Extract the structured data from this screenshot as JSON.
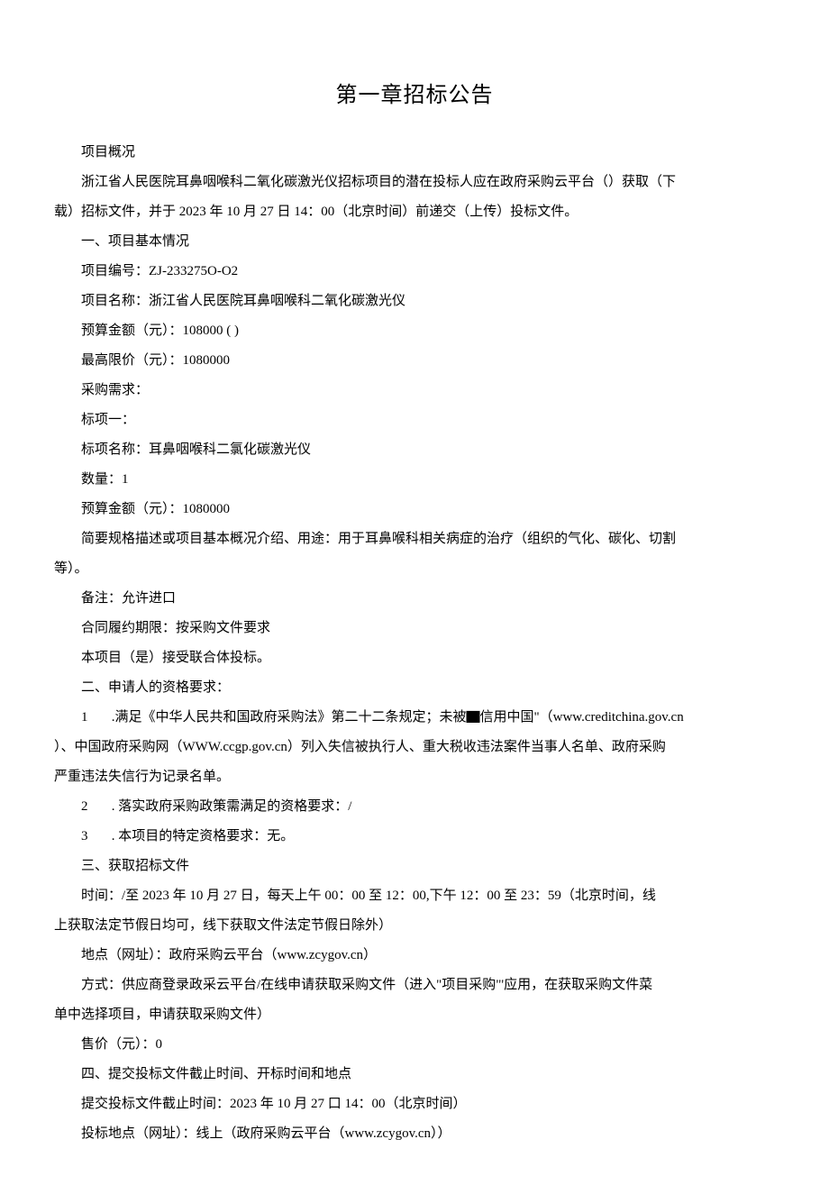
{
  "title": "第一章招标公告",
  "lines": {
    "l1": "项目概况",
    "l2": "浙江省人民医院耳鼻咽喉科二氧化碳激光仪招标项目的潜在投标人应在政府采购云平台（）获取（下",
    "l3": "载）招标文件，并于 2023 年 10 月 27 日 14：00（北京时间）前递交（上传）投标文件。",
    "l4": "一、项目基本情况",
    "l5": "项目编号：ZJ-233275O-O2",
    "l6": "项目名称：浙江省人民医院耳鼻咽喉科二氧化碳激光仪",
    "l7": "预算金额（元）：108000 ( )",
    "l8": "最高限价（元）：1080000",
    "l9": "采购需求：",
    "l10": "标项一：",
    "l11": "标项名称：耳鼻咽喉科二氯化碳激光仪",
    "l12": "数量：1",
    "l13": "预算金额（元）：1080000",
    "l14": "简要规格描述或项目基本概况介绍、用途：用于耳鼻喉科相关病症的治疗（组织的气化、碳化、切割",
    "l15": "等）。",
    "l16": "备注：允许进口",
    "l17": "合同履约期限：按采购文件要求",
    "l18": "本项目（是）接受联合体投标。",
    "l19": "二、申请人的资格要求：",
    "l20a": "1",
    "l20b": " .满足《中华人民共和国政府采购法》第二十二条规定；未被▇信用中国\"（www.creditchina.gov.cn",
    "l21": "）、中国政府采购网（WWW.ccgp.gov.cn）列入失信被执行人、重大税收违法案件当事人名单、政府采购",
    "l22": "严重违法失信行为记录名单。",
    "l23a": "2",
    "l23b": " . 落实政府采购政策需满足的资格要求：/",
    "l24a": "3",
    "l24b": " . 本项目的特定资格要求：无。",
    "l25": "三、获取招标文件",
    "l26": "时间：/至 2023 年 10 月 27 日，每天上午 00：00 至 12：00,下午 12：00 至 23：59（北京时间，线",
    "l27": "上获取法定节假日均可，线下获取文件法定节假日除外）",
    "l28": "地点（网址）：政府采购云平台（www.zcygov.cn）",
    "l29": "方式：供应商登录政采云平台/在线申请获取采购文件（进入\"项目采购\"'应用，在获取采购文件菜",
    "l30": "单中选择项目，申请获取采购文件）",
    "l31": "售价（元）：0",
    "l32": "四、提交投标文件截止时间、开标时间和地点",
    "l33": "提交投标文件截止时间：2023 年 10 月 27 口 14：00（北京时间）",
    "l34": "投标地点（网址）：线上（政府采购云平台（www.zcygov.cn））"
  }
}
